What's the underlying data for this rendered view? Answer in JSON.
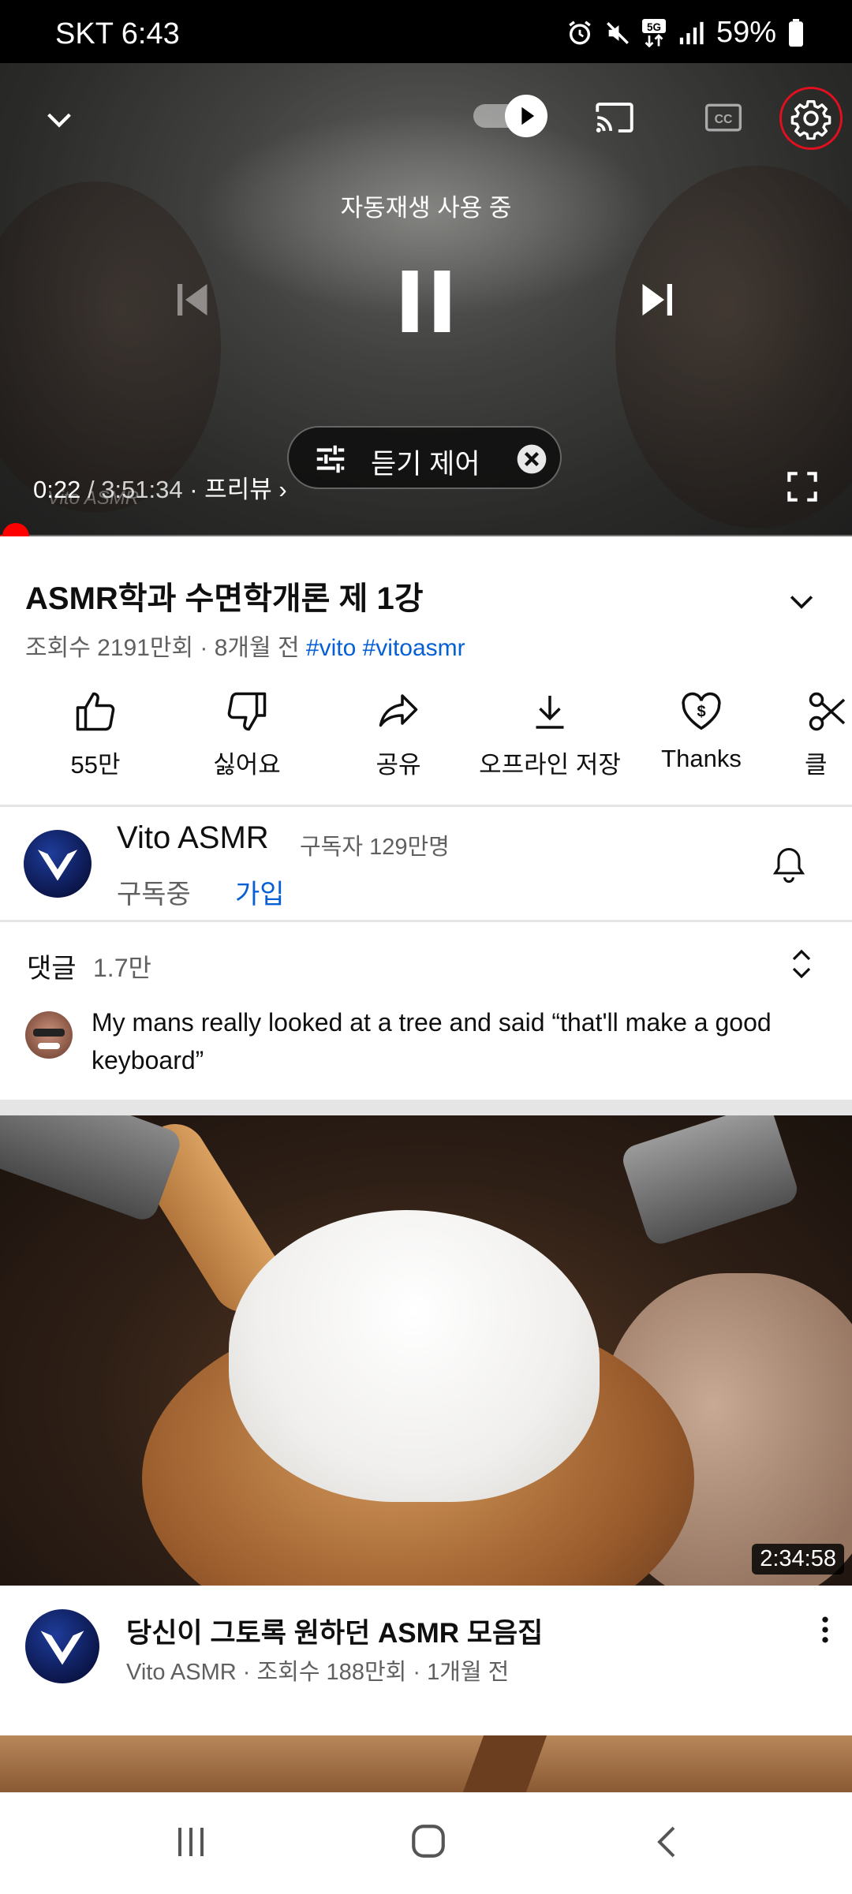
{
  "status_bar": {
    "carrier_time": "SKT 6:43",
    "battery": "59%"
  },
  "player": {
    "autoplay_label": "자동재생 사용 중",
    "time_current": "0:22",
    "time_total": "/ 3:51:34",
    "preview_label": "· 프리뷰 ›",
    "listen_control": "듣기 제어",
    "watermark": "Vito ASMR",
    "progress_fraction": 0.0016
  },
  "video": {
    "title": "ASMR학과 수면학개론 제 1강",
    "meta": "조회수 2191만회 · 8개월 전",
    "tags": [
      "#vito",
      "#vitoasmr"
    ]
  },
  "actions": {
    "like": "55만",
    "dislike": "싫어요",
    "share": "공유",
    "offline": "오프라인 저장",
    "thanks": "Thanks",
    "clip": "클"
  },
  "channel": {
    "name": "Vito ASMR",
    "subscribers": "구독자 129만명",
    "subscribed": "구독중",
    "join": "가입"
  },
  "comments": {
    "label": "댓글",
    "count": "1.7만",
    "top_comment": "My mans really looked at a tree and said “that'll make a good keyboard”"
  },
  "recommendation": {
    "duration": "2:34:58",
    "title": "당신이 그토록 원하던 ASMR 모음집",
    "meta": "Vito ASMR · 조회수 188만회 · 1개월 전"
  },
  "colors": {
    "accent_red": "#ff0000",
    "link_blue": "#065fd4",
    "secondary_text": "#606060"
  }
}
